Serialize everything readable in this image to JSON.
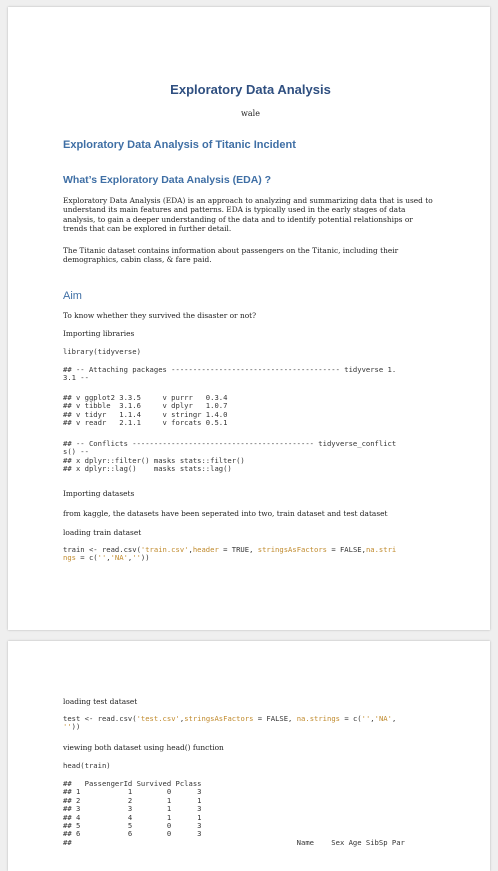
{
  "doc": {
    "title": "Exploratory Data Analysis",
    "author": "wale",
    "heading_main": "Exploratory Data Analysis of Titanic Incident",
    "heading_eda": "What’s Exploratory Data Analysis (EDA) ?",
    "para_eda": "Exploratory Data Analysis (EDA) is an approach to analyzing and summarizing data that is used to understand its main features and patterns. EDA is typically used in the early stages of data analysis, to gain a deeper understanding of the data and to identify potential relationships or trends that can be explored in further detail.",
    "para_titanic": "The Titanic dataset contains information about passengers on the Titanic, including their demographics, cabin class, & fare paid.",
    "heading_aim": "Aim",
    "aim_text": "To know whether they survived the disaster or not?",
    "importing_libraries": "Importing libraries",
    "code_library": "library(tidyverse)",
    "out_attaching_1": "## -- Attaching packages --------------------------------------- tidyverse 1.",
    "out_attaching_2": "3.1 --",
    "out_pkgs": [
      "## v ggplot2 3.3.5     v purrr   0.3.4",
      "## v tibble  3.1.6     v dplyr   1.0.7",
      "## v tidyr   1.1.4     v stringr 1.4.0",
      "## v readr   2.1.1     v forcats 0.5.1"
    ],
    "out_conflicts": [
      "## -- Conflicts ------------------------------------------ tidyverse_conflict",
      "s() --",
      "## x dplyr::filter() masks stats::filter()",
      "## x dplyr::lag()    masks stats::lag()"
    ],
    "importing_datasets": "Importing datasets",
    "datasets_text": "from kaggle, the datasets have been seperated into two, train dataset and test dataset",
    "loading_train": "loading train dataset",
    "train_code": {
      "a": "train <- read.csv(",
      "b": "'train.csv'",
      "c": ",",
      "d": "header",
      "e": " = TRUE, ",
      "f": "stringsAsFactors",
      "g": " = FALSE,",
      "h": "na.stri",
      "i": "ngs",
      "j": " = c(",
      "k": "''",
      "l": ",",
      "m": "'NA'",
      "n": ",",
      "o": "''",
      "p": "))"
    },
    "loading_test": "loading test dataset",
    "test_code": {
      "a": "test <- read.csv(",
      "b": "'test.csv'",
      "c": ",",
      "d": "stringsAsFactors",
      "e": " = FALSE, ",
      "f": "na.strings",
      "g": " = c(",
      "h": "''",
      "i": ",",
      "j": "'NA'",
      "k": ",",
      "l": "''",
      "m": "))"
    },
    "viewing_text": "viewing both dataset using head() function",
    "head_code": "head(train)",
    "head_output": [
      "##   PassengerId Survived Pclass",
      "## 1           1        0      3",
      "## 2           2        1      1",
      "## 3           3        1      3",
      "## 4           4        1      1",
      "## 5           5        0      3",
      "## 6           6        0      3",
      "##                                                    Name    Sex Age SibSp Par"
    ]
  }
}
